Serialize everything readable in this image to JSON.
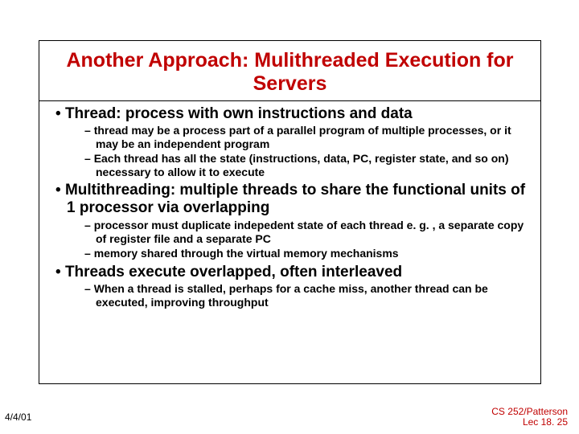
{
  "title": "Another Approach: Mulithreaded Execution for Servers",
  "bullets": [
    {
      "text": "Thread: process with own instructions and data",
      "sub": [
        "thread may be a process part of a parallel program of multiple processes, or it may be an independent program",
        "Each thread has all the state (instructions, data, PC, register state, and so on) necessary to allow it to execute"
      ]
    },
    {
      "text": "Multithreading: multiple threads to share the functional units of 1 processor via overlapping",
      "sub": [
        "processor must duplicate indepedent state of each thread e. g. , a separate copy of register file and a separate PC",
        "memory shared through the virtual memory mechanisms"
      ]
    },
    {
      "text": "Threads execute overlapped, often interleaved",
      "sub": [
        "When a thread is stalled, perhaps for a cache miss, another thread can be executed, improving throughput"
      ]
    }
  ],
  "footer": {
    "left": "4/4/01",
    "right_line1": "CS 252/Patterson",
    "right_line2": "Lec 18. 25"
  }
}
